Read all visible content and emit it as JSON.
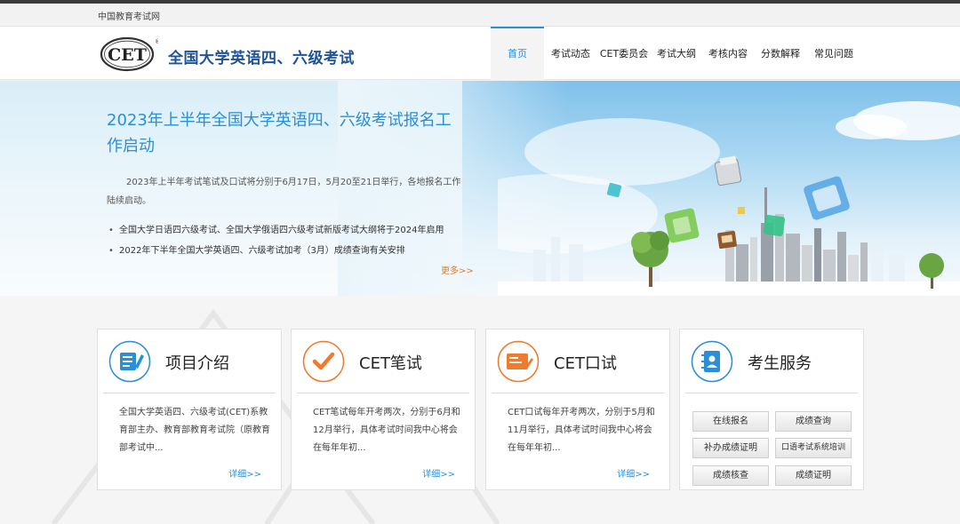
{
  "util": {
    "site_name": "中国教育考试网"
  },
  "header": {
    "logo_text": "CET",
    "brand": "全国大学英语四、六级考试"
  },
  "nav": [
    {
      "label": "首页",
      "active": true
    },
    {
      "label": "考试动态"
    },
    {
      "label": "CET委员会"
    },
    {
      "label": "考试大纲"
    },
    {
      "label": "考核内容"
    },
    {
      "label": "分数解释"
    },
    {
      "label": "常见问题"
    }
  ],
  "hero": {
    "title": "2023年上半年全国大学英语四、六级考试报名工作启动",
    "desc": "2023年上半年考试笔试及口试将分别于6月17日，5月20至21日举行，各地报名工作陆续启动。",
    "news": [
      "全国大学日语四六级考试、全国大学俄语四六级考试新版考试大纲将于2024年启用",
      "2022年下半年全国大学英语四、六级考试加考（3月）成绩查询有关安排"
    ],
    "more": "更多>>"
  },
  "cards": [
    {
      "title": "项目介绍",
      "desc": "全国大学英语四、六级考试(CET)系教育部主办、教育部教育考试院（原教育部考试中...",
      "more": "详细>>",
      "icon": "document-pen-icon"
    },
    {
      "title": "CET笔试",
      "desc": "CET笔试每年开考两次，分别于6月和12月举行，具体考试时间我中心将会在每年年初...",
      "more": "详细>>",
      "icon": "checkmark-icon"
    },
    {
      "title": "CET口试",
      "desc": "CET口试每年开考两次，分别于5月和11月举行，具体考试时间我中心将会在每年年初...",
      "more": "详细>>",
      "icon": "certificate-icon"
    }
  ],
  "services": {
    "title": "考生服务",
    "icon": "contact-book-icon",
    "buttons": [
      "在线报名",
      "成绩查询",
      "补办成绩证明",
      "口语考试系统培训",
      "成绩核查",
      "成绩证明"
    ]
  },
  "colors": {
    "accent_blue": "#2a8fd6",
    "brand_navy": "#1f5396",
    "more_orange": "#e07b2a",
    "icon_orange": "#f07a2e"
  }
}
